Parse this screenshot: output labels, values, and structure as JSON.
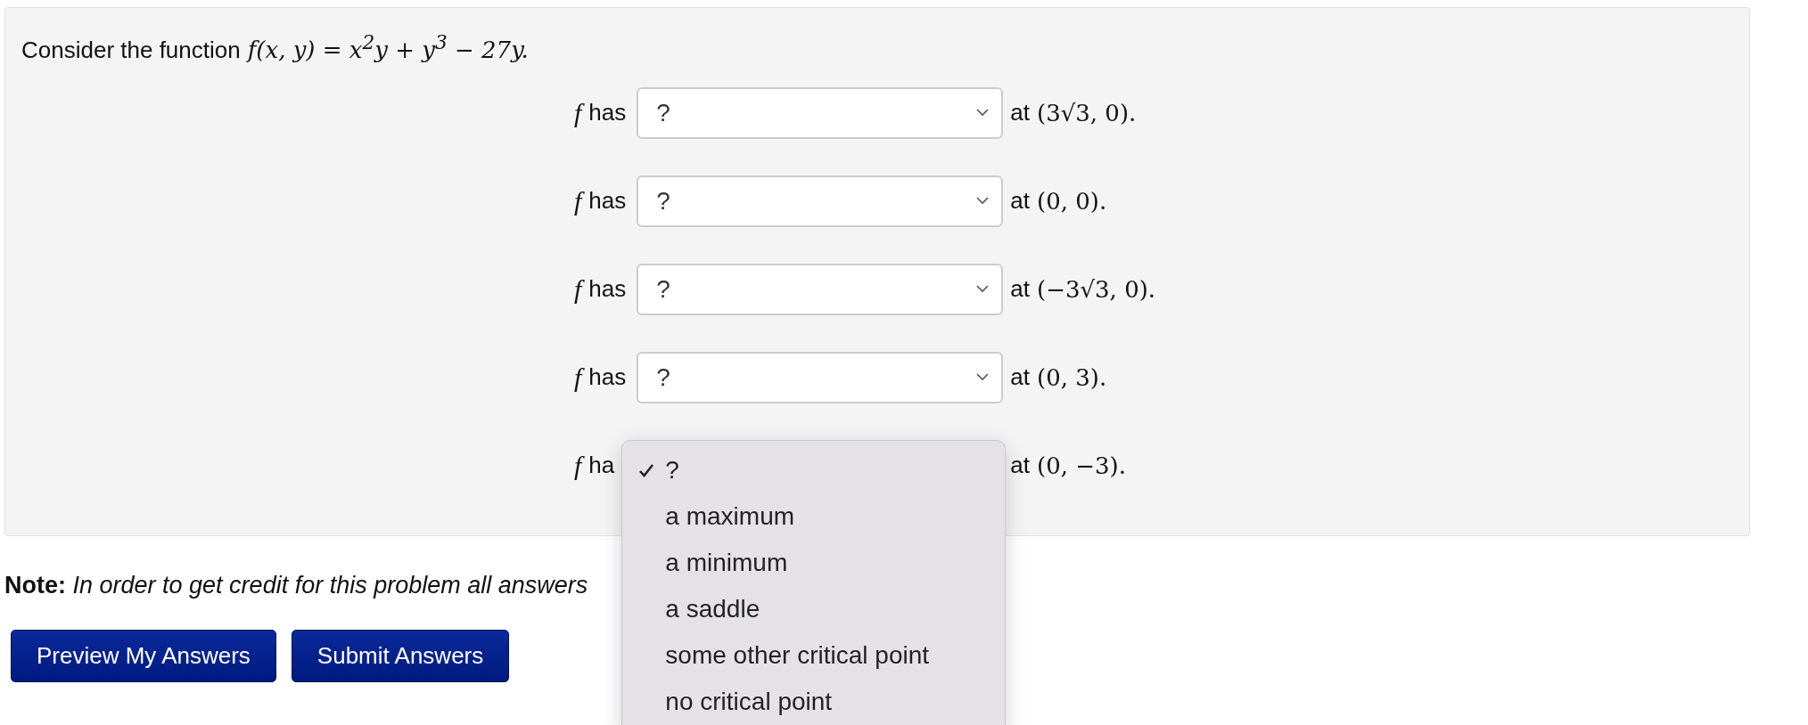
{
  "problem": {
    "intro": "Consider the function",
    "formula": "f(x, y) = x$^{2}$y + y$^{3}$ − 27y.",
    "rows": [
      {
        "kind": "closed",
        "f": "f",
        "label": "has",
        "value": "?",
        "at": "at",
        "point": "(3√3, 0)."
      },
      {
        "kind": "closed",
        "f": "f",
        "label": "has",
        "value": "?",
        "at": "at",
        "point": "(0, 0)."
      },
      {
        "kind": "closed",
        "f": "f",
        "label": "has",
        "value": "?",
        "at": "at",
        "point": "(−3√3, 0)."
      },
      {
        "kind": "closed",
        "f": "f",
        "label": "has",
        "value": "?",
        "at": "at",
        "point": "(0, 3)."
      },
      {
        "kind": "open",
        "f": "f",
        "label": "ha",
        "at": "at",
        "point": "(0, −3).",
        "options": [
          {
            "label": "?",
            "selected": true
          },
          {
            "label": "a maximum",
            "selected": false
          },
          {
            "label": "a minimum",
            "selected": false
          },
          {
            "label": "a saddle",
            "selected": false
          },
          {
            "label": "some other critical point",
            "selected": false
          },
          {
            "label": "no critical point",
            "selected": false
          }
        ]
      }
    ]
  },
  "note": "**Note:** *In order to get credit for this problem all answers*",
  "buttons": [
    "Preview My Answers",
    "Submit Answers"
  ]
}
